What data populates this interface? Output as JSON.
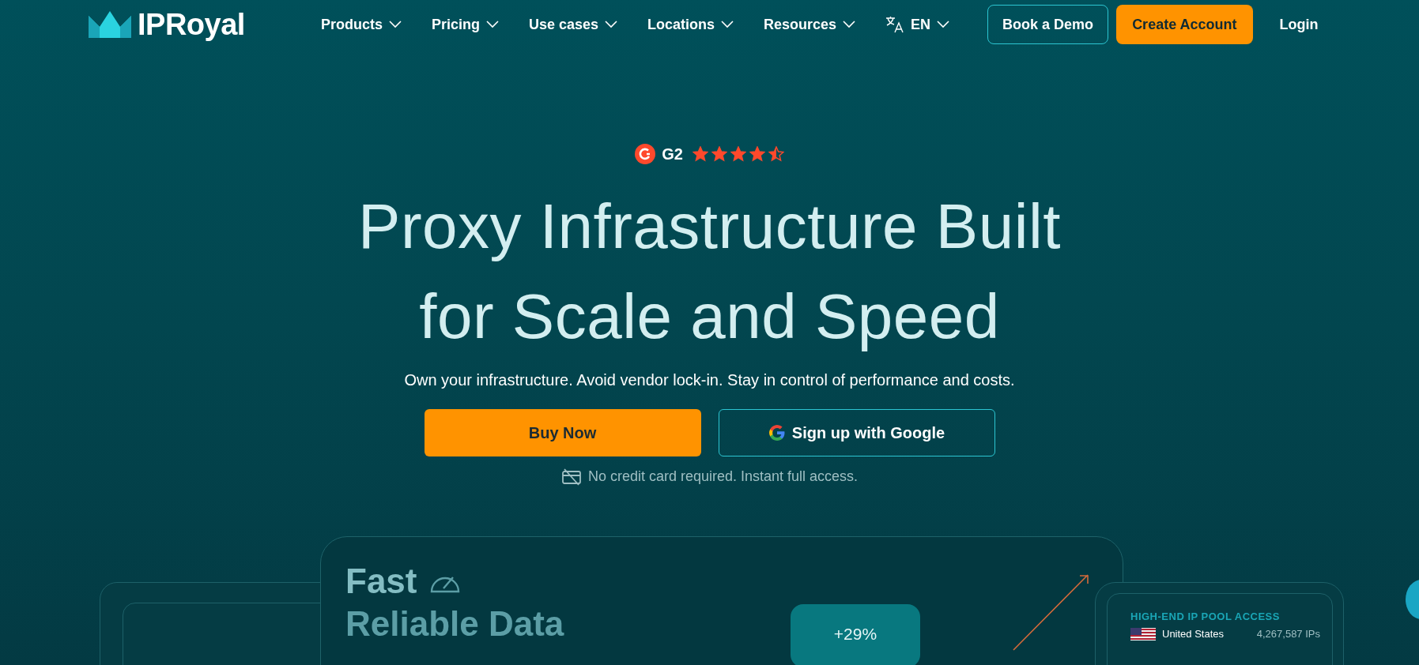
{
  "logo": {
    "text": "IPRoyal"
  },
  "nav": {
    "items": [
      {
        "label": "Products"
      },
      {
        "label": "Pricing"
      },
      {
        "label": "Use cases"
      },
      {
        "label": "Locations"
      },
      {
        "label": "Resources"
      }
    ],
    "language": {
      "label": "EN"
    },
    "buttons": [
      {
        "label": "Book a Demo",
        "kind": "outline"
      },
      {
        "label": "Create Account",
        "kind": "primary"
      },
      {
        "label": "Login",
        "kind": "link"
      }
    ]
  },
  "rating": {
    "label": "G2",
    "stars": 4.5
  },
  "hero": {
    "title_lines": [
      "Proxy Infrastructure Built",
      "for Scale and Speed"
    ],
    "subtitle": "Own your infrastructure. Avoid vendor lock-in. Stay in control of performance and costs.",
    "buttons": [
      {
        "label": "Buy Now",
        "kind": "primary"
      },
      {
        "label": "Sign up with Google",
        "kind": "google"
      }
    ],
    "note": "No credit card required. Instant full access."
  },
  "preview": {
    "headline_lines": [
      "Fast",
      "Reliable Data"
    ],
    "growth": "+29%",
    "pool": {
      "title": "HIGH-END IP POOL ACCESS",
      "rows": [
        {
          "country": "United States",
          "count": "4,267,587 IPs"
        }
      ]
    }
  }
}
